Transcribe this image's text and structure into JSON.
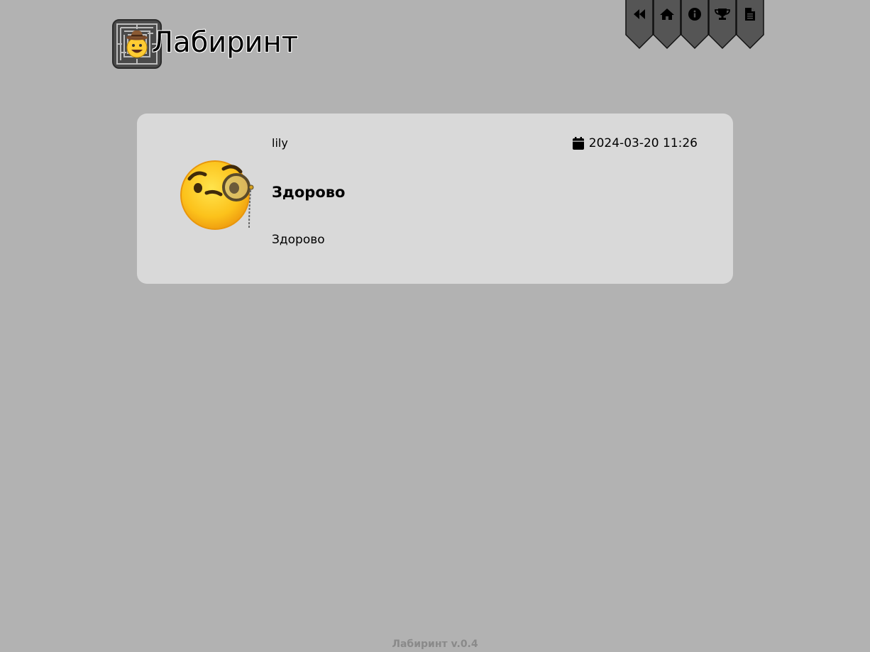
{
  "header": {
    "title": "Лабиринт",
    "logo_icon": "maze-smiley-logo-icon"
  },
  "nav": {
    "items": [
      {
        "icon": "rewind-icon",
        "name": "nav-back"
      },
      {
        "icon": "home-icon",
        "name": "nav-home"
      },
      {
        "icon": "info-icon",
        "name": "nav-info"
      },
      {
        "icon": "trophy-icon",
        "name": "nav-trophy"
      },
      {
        "icon": "document-icon",
        "name": "nav-document"
      }
    ],
    "banner_color": "#555555"
  },
  "message": {
    "author": "lily",
    "date": "2024-03-20 11:26",
    "subject": "Здорово",
    "body": "Здорово",
    "avatar_icon": "face-with-monocle-emoji-icon"
  },
  "footer": {
    "version_text": "Лабиринт v.0.4"
  }
}
